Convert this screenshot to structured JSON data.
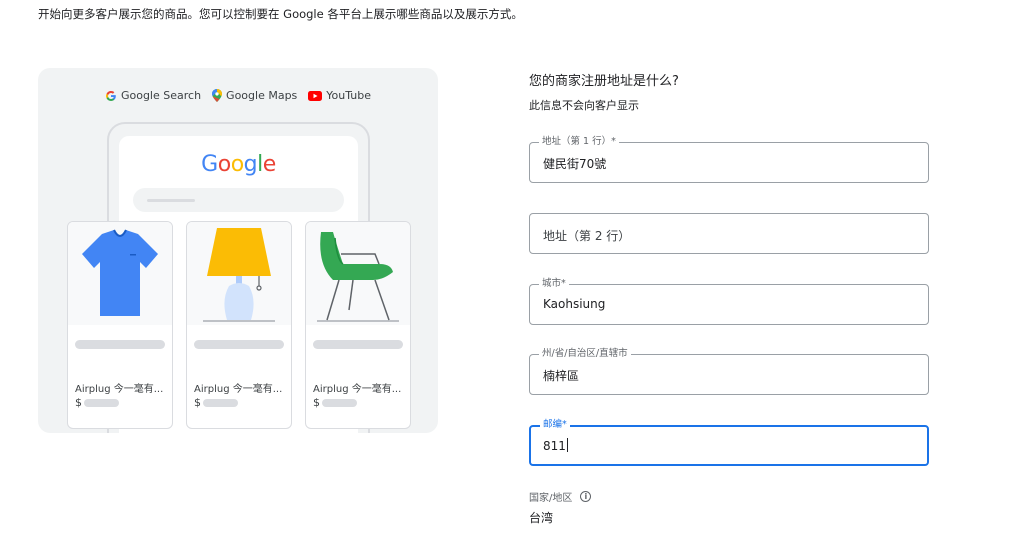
{
  "intro_text": "开始向更多客户展示您的商品。您可以控制要在 Google 各平台上展示哪些商品以及展示方式。",
  "illustration": {
    "platforms": [
      {
        "label": "Google Search",
        "icon": "google-g-icon"
      },
      {
        "label": "Google Maps",
        "icon": "maps-pin-icon"
      },
      {
        "label": "YouTube",
        "icon": "youtube-icon"
      }
    ],
    "logo_text": "Google",
    "products": [
      {
        "title": "Airplug 今一毫有...",
        "currency": "$",
        "image": "tshirt"
      },
      {
        "title": "Airplug 今一毫有...",
        "currency": "$",
        "image": "lamp"
      },
      {
        "title": "Airplug 今一毫有...",
        "currency": "$",
        "image": "chair"
      }
    ]
  },
  "form": {
    "heading": "您的商家注册地址是什么?",
    "subheading": "此信息不会向客户显示",
    "address1": {
      "label": "地址（第 1 行）*",
      "value": "健民街70號"
    },
    "address2": {
      "placeholder": "地址（第 2 行）"
    },
    "city": {
      "label": "城市*",
      "value": "Kaohsiung"
    },
    "state": {
      "label": "州/省/自治区/直辖市",
      "value": "楠梓區"
    },
    "zip": {
      "label": "邮编*",
      "value": "811"
    },
    "country": {
      "label": "国家/地区",
      "value": "台湾"
    }
  },
  "colors": {
    "focus": "#1a73e8",
    "border": "#9aa0a6"
  }
}
